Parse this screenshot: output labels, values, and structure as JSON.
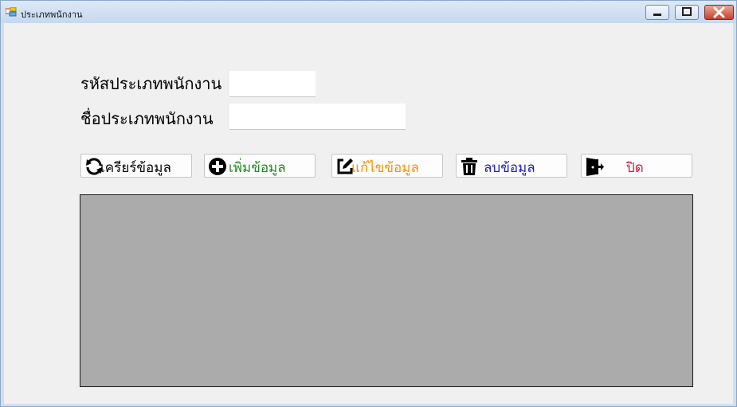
{
  "window": {
    "title": "ประเภทพนักงาน",
    "controls": [
      "minimize-icon",
      "maximize-icon",
      "close-icon"
    ]
  },
  "form": {
    "code_label": "รหัสประเภทพนักงาน",
    "code_value": "",
    "name_label": "ชื่อประเภทพนักงาน",
    "name_value": ""
  },
  "buttons": {
    "clear": {
      "label": "เครียร์ข้อมูล",
      "icon": "refresh-icon",
      "color": "#000000"
    },
    "add": {
      "label": "เพิ่มข้อมูล",
      "icon": "plus-circle-icon",
      "color": "#1e8a1e"
    },
    "edit": {
      "label": "แก้ไขข้อมูล",
      "icon": "edit-icon",
      "color": "#ff8c00"
    },
    "delete": {
      "label": "ลบข้อมูล",
      "icon": "trash-icon",
      "color": "#1a1acc"
    },
    "close": {
      "label": "ปิด",
      "icon": "exit-icon",
      "color": "#dc143c"
    }
  },
  "grid": {
    "background": "#ababab"
  }
}
